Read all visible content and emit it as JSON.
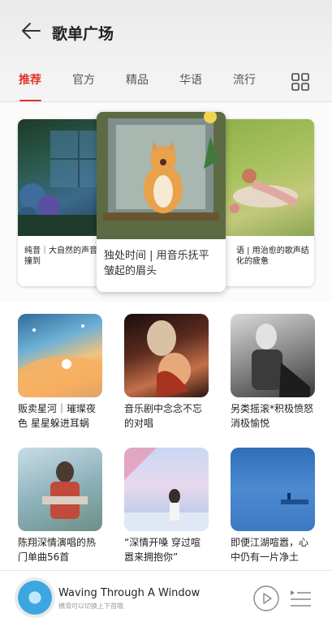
{
  "header": {
    "title": "歌单广场"
  },
  "tabs": [
    {
      "label": "推荐",
      "active": true
    },
    {
      "label": "官方"
    },
    {
      "label": "精品"
    },
    {
      "label": "华语"
    },
    {
      "label": "流行"
    }
  ],
  "carousel": {
    "left_caption": "纯音｜大自然的声音碰撞到",
    "center_caption": "独处时间 | 用音乐抚平皱起的眉头",
    "right_caption": "语 | 用治愈的歌声结化的疲惫"
  },
  "playlists": [
    {
      "name": "贩卖星河｜璀璨夜色 星星躲进耳蜗"
    },
    {
      "name": "音乐剧中念念不忘的对唱"
    },
    {
      "name": "另类摇滚*积极愤怒消极愉悦"
    },
    {
      "name": "陈翔深情演唱的热门单曲56首"
    },
    {
      "name": "“深情开嗓 穿过喧嚣来拥抱你”"
    },
    {
      "name": "即便江湖喧嚣，心中仍有一片净土"
    }
  ],
  "player": {
    "title": "Waving Through A Window",
    "subtitle": "横滑可以切换上下首哦"
  },
  "colors": {
    "accent": "#e1342a"
  }
}
